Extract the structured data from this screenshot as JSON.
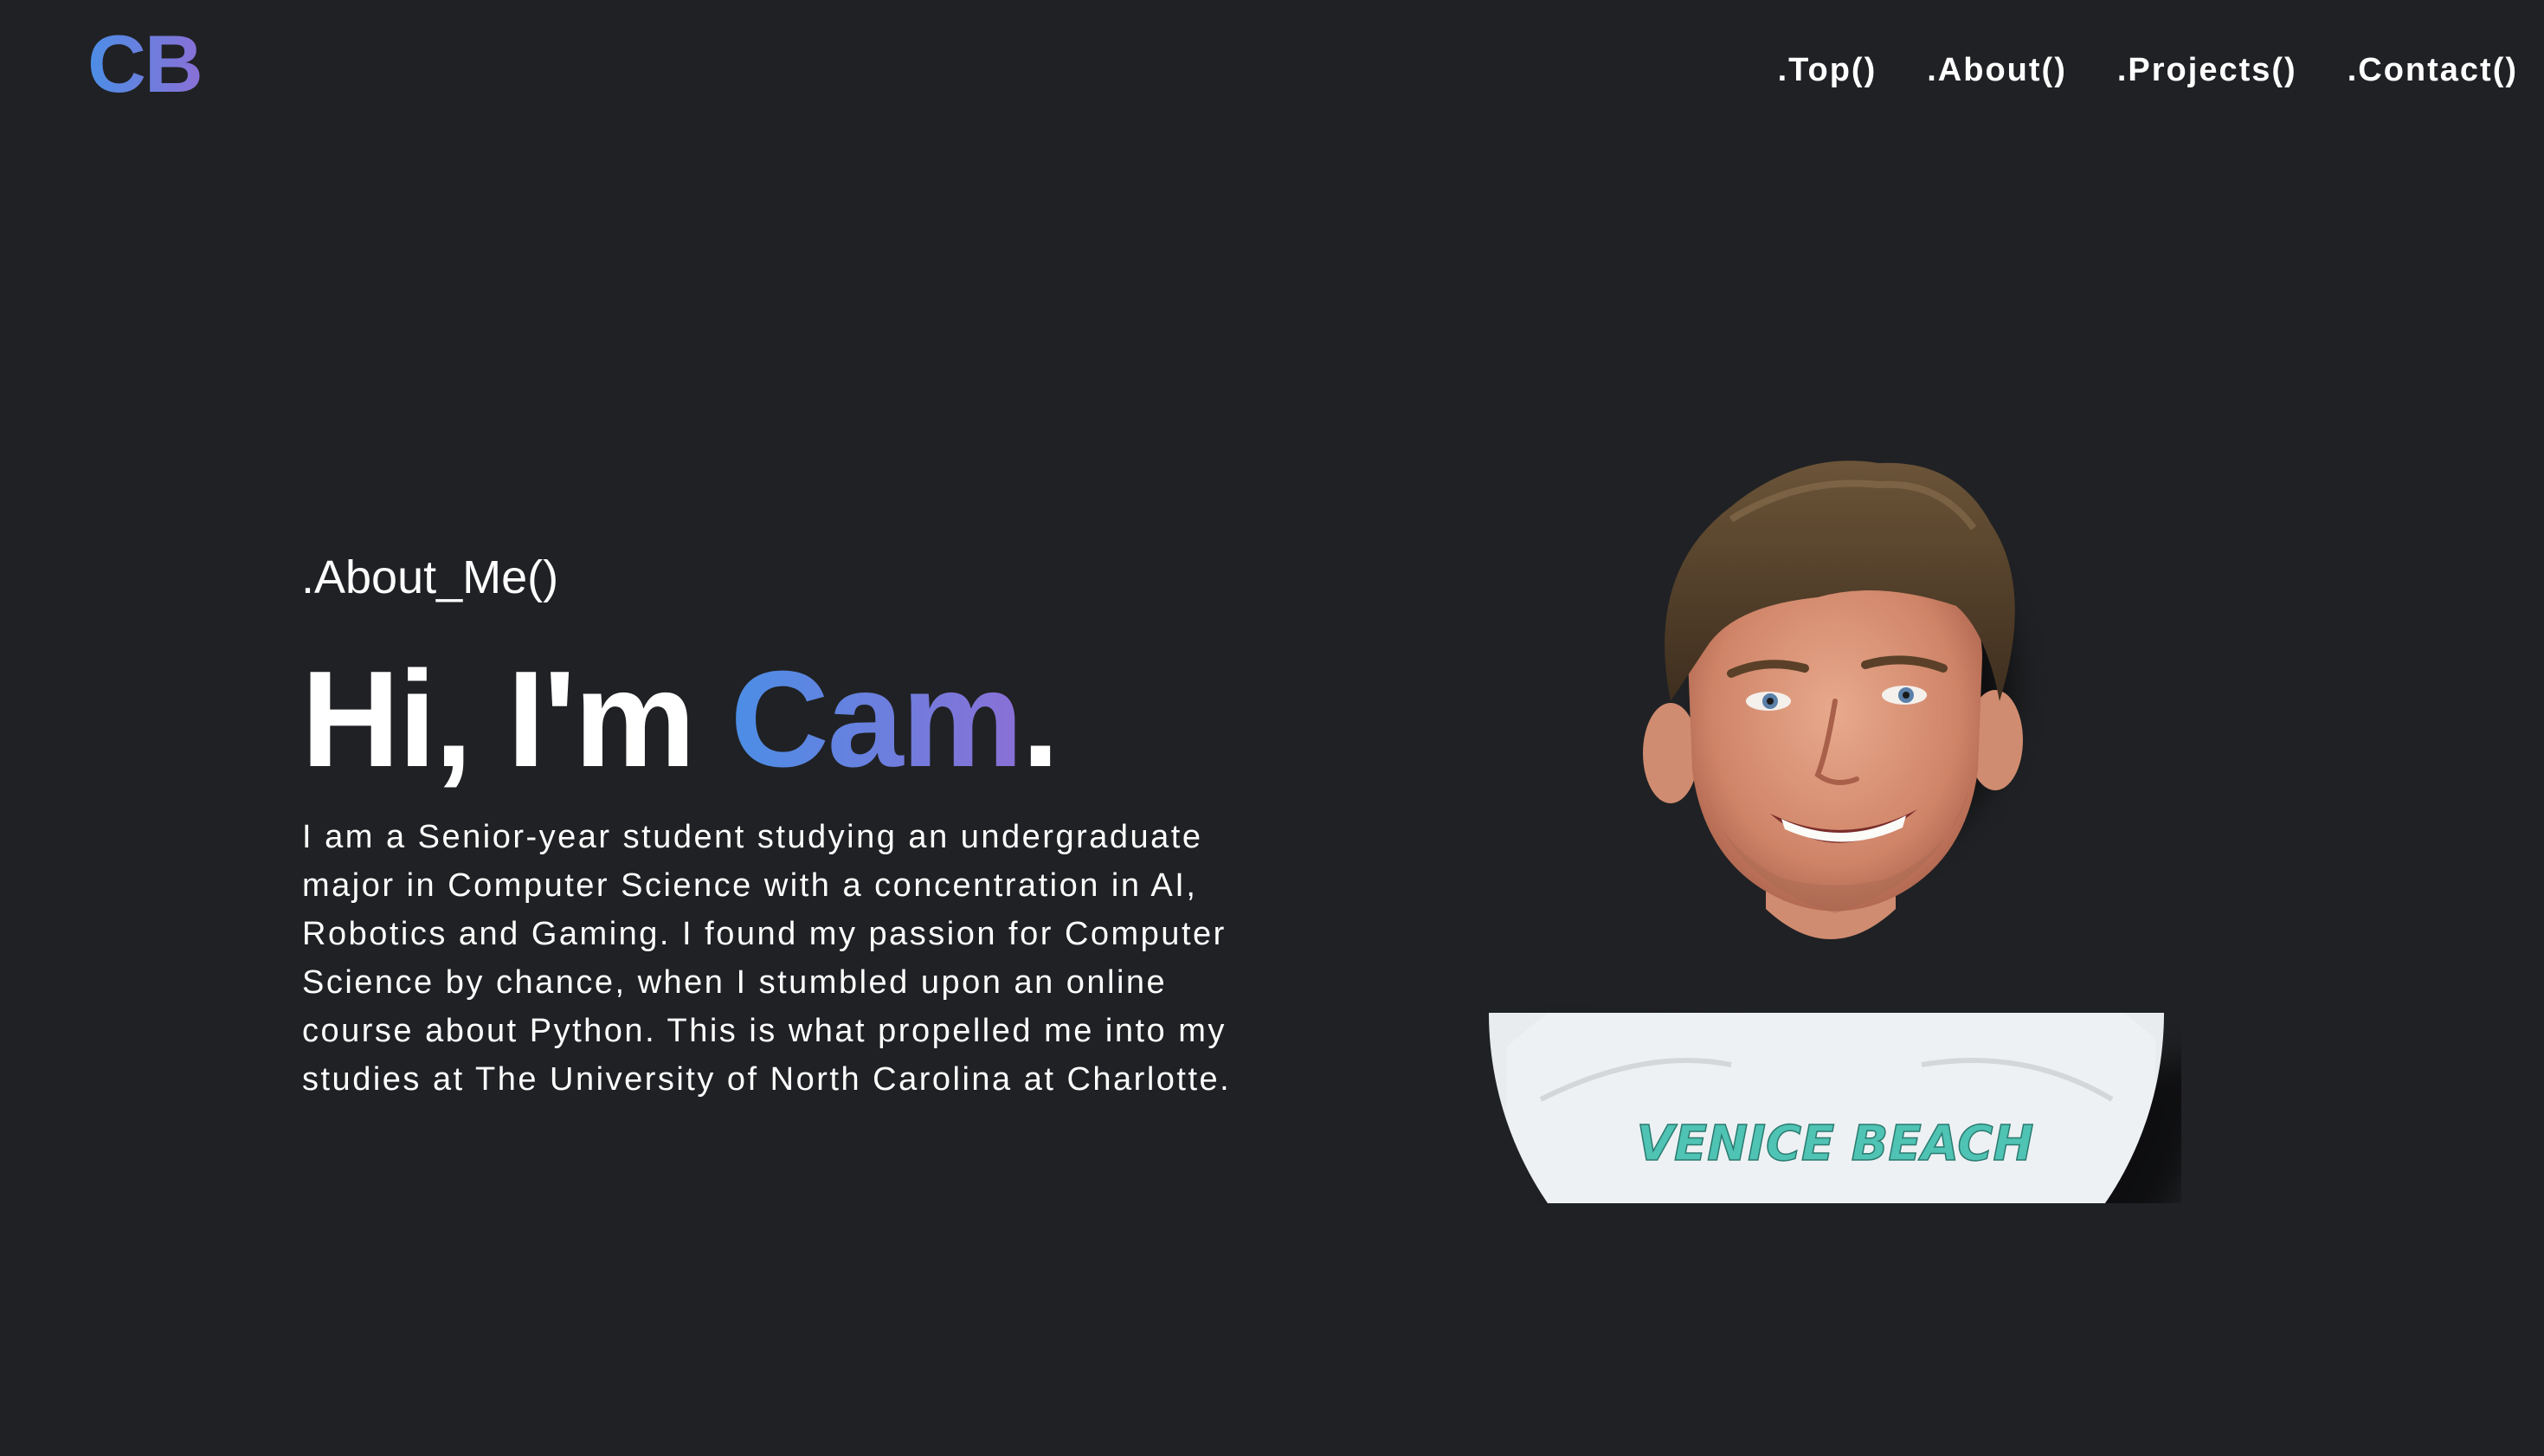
{
  "header": {
    "logo": "CB",
    "nav": [
      {
        "label": ".Top()"
      },
      {
        "label": ".About()"
      },
      {
        "label": ".Projects()"
      },
      {
        "label": ".Contact()"
      }
    ]
  },
  "about": {
    "section_label": ".About_Me()",
    "greeting": "Hi, I'm ",
    "name": "Cam",
    "punctuation": ".",
    "bio": "I am a Senior-year student studying an undergraduate major in Computer Science with a concentration in AI, Robotics and Gaming. I found my passion for Computer Science by chance, when I stumbled upon an online course about Python. This is what propelled me into my studies at The University of North Carolina at Charlotte.",
    "shirt_text": "VENICE BEACH"
  },
  "colors": {
    "background": "#202124",
    "accent_start": "#4b8ee6",
    "accent_end": "#8a70d6",
    "text": "#ffffff"
  }
}
